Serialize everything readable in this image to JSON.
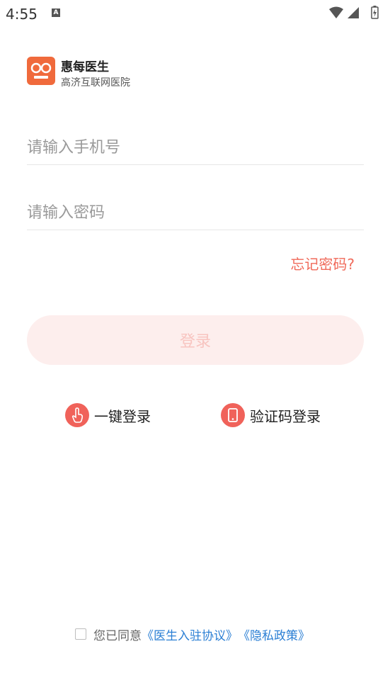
{
  "status_bar": {
    "time": "4:55",
    "notification_icon": "A",
    "icons": [
      "wifi-icon",
      "signal-icon",
      "battery-charging-icon"
    ]
  },
  "brand": {
    "name": "惠每医生",
    "subtitle": "高济互联网医院",
    "logo_color": "#f06a3c"
  },
  "form": {
    "phone_placeholder": "请输入手机号",
    "phone_value": "",
    "password_placeholder": "请输入密码",
    "password_value": "",
    "forgot_label": "忘记密码?",
    "login_label": "登录"
  },
  "alt_login": {
    "one_key_label": "一键登录",
    "sms_label": "验证码登录"
  },
  "agreement": {
    "checked": false,
    "prefix": "您已同意",
    "doctor_agreement": "《医生入驻协议》",
    "privacy_policy": "《隐私政策》"
  },
  "colors": {
    "accent": "#f06a5a",
    "login_button_bg": "#fdeeed",
    "link": "#2b7fd4"
  }
}
